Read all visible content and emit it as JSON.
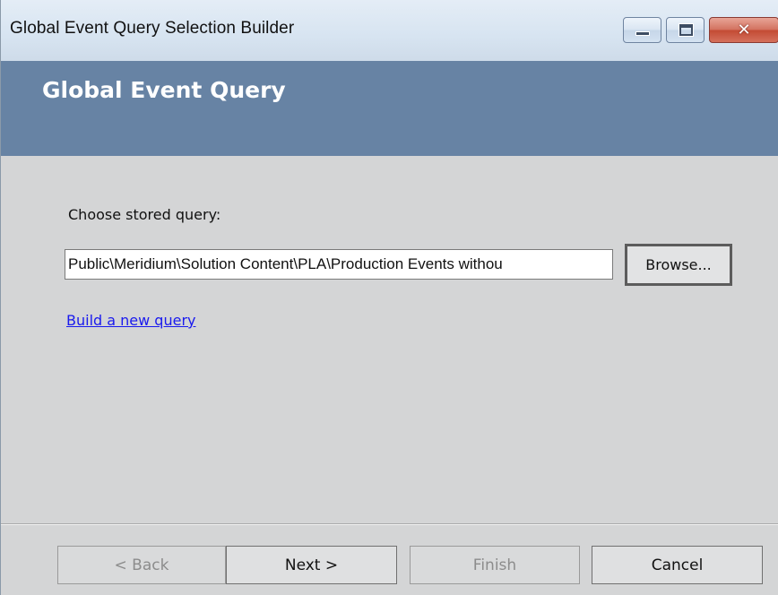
{
  "window": {
    "title": "Global Event Query Selection Builder",
    "controls": {
      "minimize_icon": "minimize-icon",
      "maximize_icon": "maximize-icon",
      "close_icon": "close-icon",
      "close_glyph": "✕"
    }
  },
  "header": {
    "title": "Global Event Query"
  },
  "form": {
    "stored_query_label": "Choose stored query:",
    "stored_query_value": "Public\\Meridium\\Solution Content\\PLA\\Production Events withou",
    "browse_label": "Browse...",
    "build_link": "Build a new query"
  },
  "footer": {
    "back_label": "< Back",
    "next_label": "Next >",
    "finish_label": "Finish",
    "cancel_label": "Cancel"
  },
  "colors": {
    "header_bg": "#6783a4",
    "content_bg": "#d4d5d6",
    "link": "#1a1aee"
  }
}
